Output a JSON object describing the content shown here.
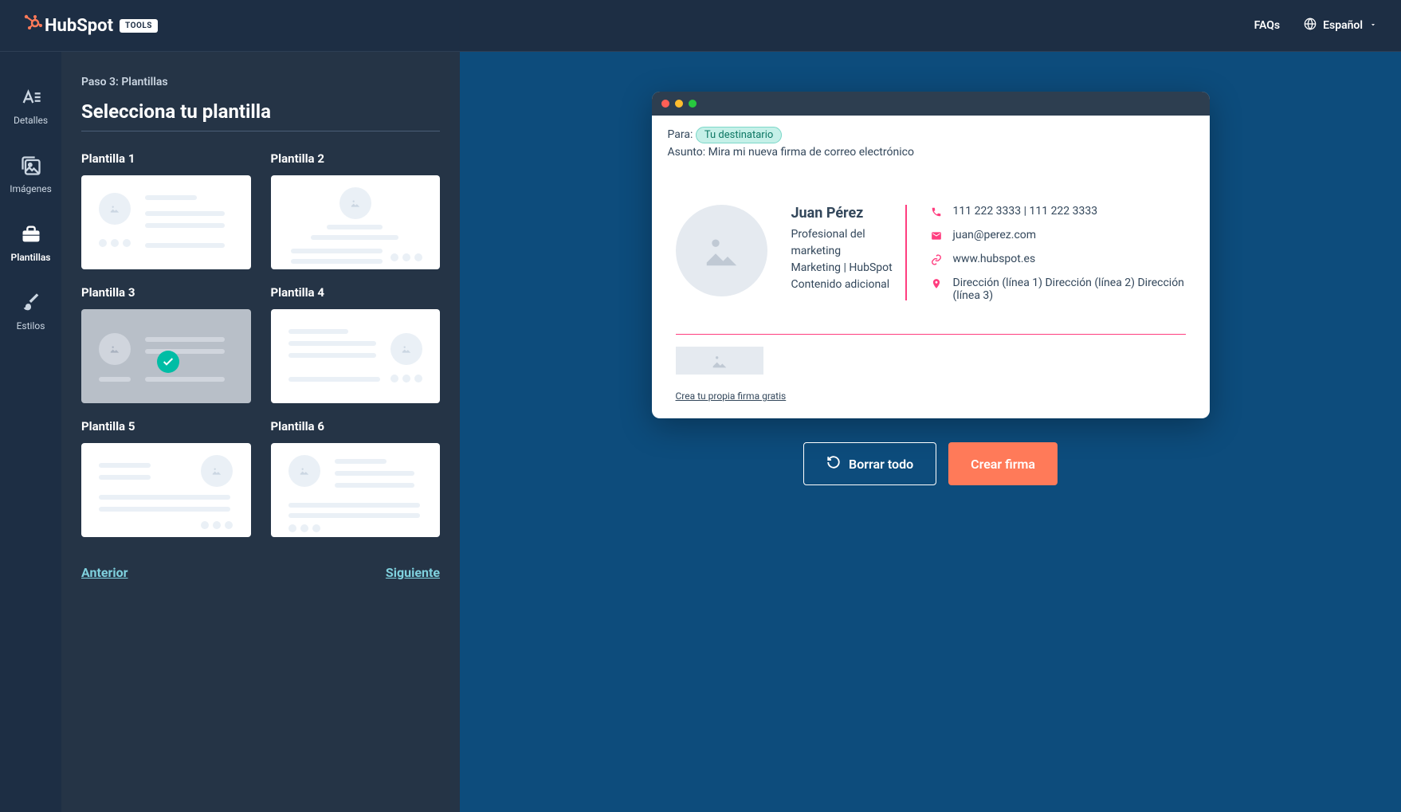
{
  "header": {
    "brand": "HubSpot",
    "tools_badge": "TOOLS",
    "faq_label": "FAQs",
    "language": "Español"
  },
  "sidebar": {
    "items": [
      {
        "label": "Detalles"
      },
      {
        "label": "Imágenes"
      },
      {
        "label": "Plantillas"
      },
      {
        "label": "Estilos"
      }
    ]
  },
  "panel": {
    "step_label": "Paso 3: Plantillas",
    "title": "Selecciona tu plantilla",
    "templates": [
      {
        "label": "Plantilla 1"
      },
      {
        "label": "Plantilla 2"
      },
      {
        "label": "Plantilla 3"
      },
      {
        "label": "Plantilla 4"
      },
      {
        "label": "Plantilla 5"
      },
      {
        "label": "Plantilla 6"
      }
    ],
    "prev_label": "Anterior",
    "next_label": "Siguiente"
  },
  "preview": {
    "to_label": "Para:",
    "recipient": "Tu destinatario",
    "subject_label": "Asunto:",
    "subject_value": "Mira mi nueva firma de correo electrónico",
    "signature": {
      "name": "Juan Pérez",
      "title": "Profesional del marketing",
      "dept": "Marketing | HubSpot",
      "extra": "Contenido adicional",
      "phone": "111 222 3333 | 111 222 3333",
      "email": "juan@perez.com",
      "website": "www.hubspot.es",
      "address": "Dirección (línea 1) Dirección (línea 2) Dirección (línea 3)"
    },
    "footer_link": "Crea tu propia firma gratis"
  },
  "actions": {
    "clear_label": "Borrar todo",
    "create_label": "Crear firma"
  }
}
